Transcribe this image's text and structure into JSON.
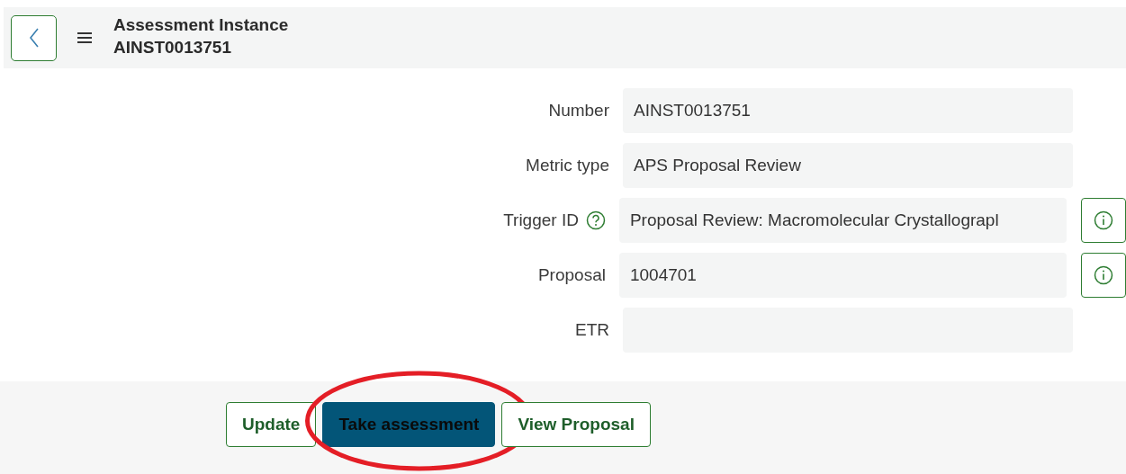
{
  "header": {
    "title": "Assessment Instance",
    "subtitle": "AINST0013751"
  },
  "fields": [
    {
      "label": "Number",
      "value": "AINST0013751",
      "help": false,
      "info": false
    },
    {
      "label": "Metric type",
      "value": "APS Proposal Review",
      "help": false,
      "info": false
    },
    {
      "label": "Trigger ID",
      "value": "Proposal Review: Macromolecular Crystallograpl",
      "help": true,
      "info": true
    },
    {
      "label": "Proposal",
      "value": "1004701",
      "help": false,
      "info": true
    },
    {
      "label": "ETR",
      "help": false,
      "info": false
    }
  ],
  "buttons": [
    {
      "label": "Update",
      "kind": "outline",
      "circled": false
    },
    {
      "label": "Take assessment",
      "kind": "primary",
      "circled": true
    },
    {
      "label": "View Proposal",
      "kind": "outline",
      "circled": false
    }
  ]
}
